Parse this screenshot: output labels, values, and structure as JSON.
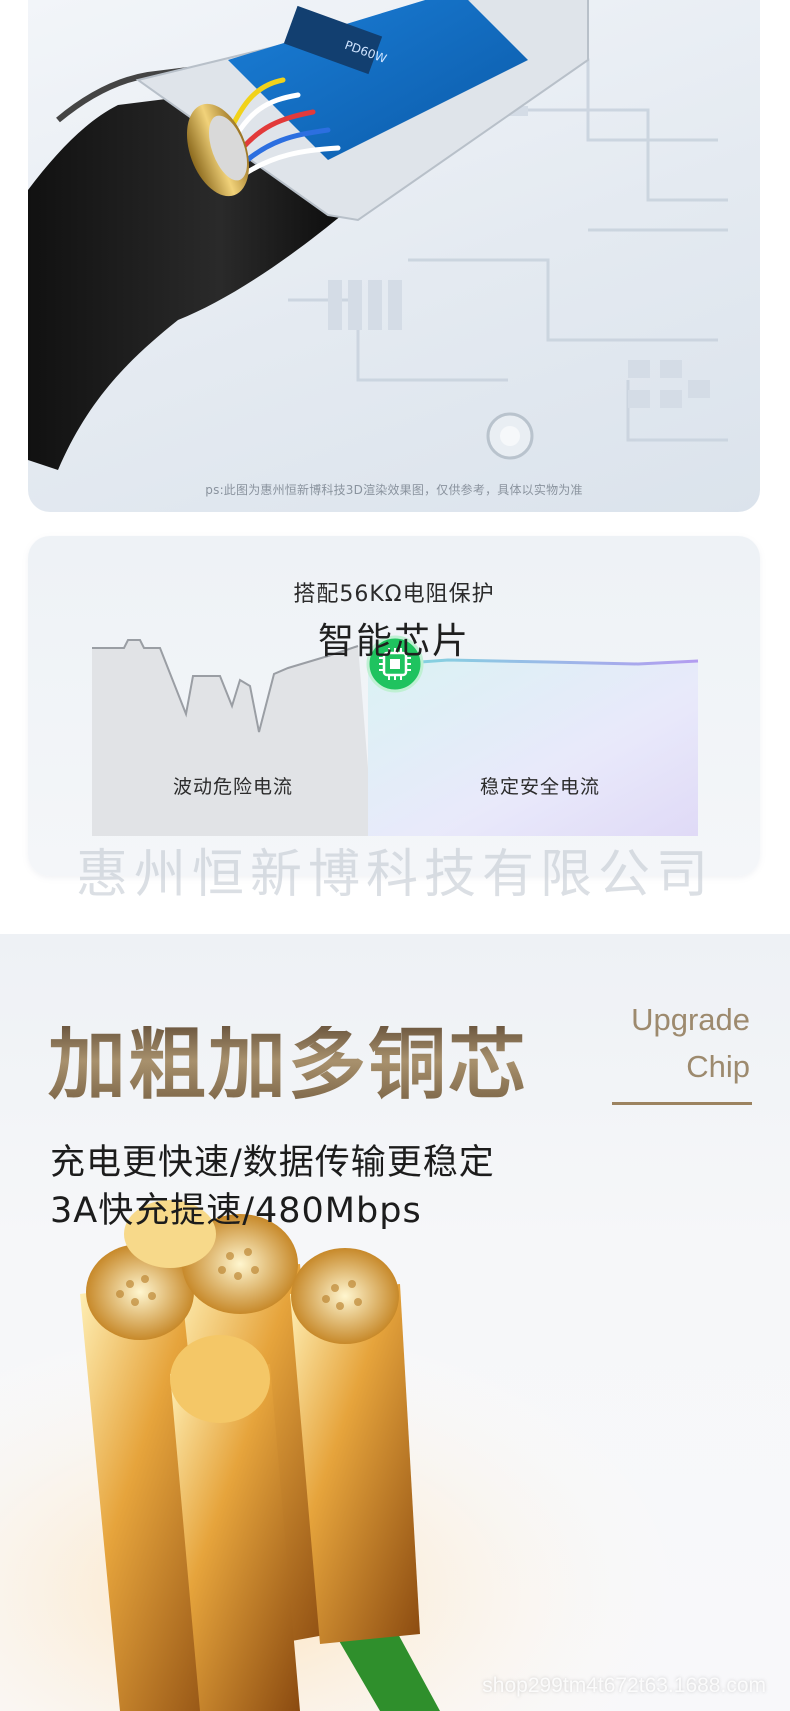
{
  "render": {
    "chip_label": "PD60W",
    "note": "ps:此图为惠州恒新博科技3D渲染效果图，仅供参考，具体以实物为准"
  },
  "smart_chip": {
    "subtitle": "搭配56KΩ电阻保护",
    "title": "智能芯片",
    "left_caption": "波动危险电流",
    "right_caption": "稳定安全电流",
    "chip_icon": "chip-icon",
    "accent_color": "#1fc35f"
  },
  "watermark": {
    "company": "惠州恒新博科技有限公司"
  },
  "copper": {
    "en_line1": "Upgrade",
    "en_line2": "Chip",
    "title": "加粗加多铜芯",
    "desc_line1": "充电更快速/数据传输更稳定",
    "desc_line2": "3A快充提速/480Mbps",
    "title_color": "#8a7352"
  },
  "footer": {
    "shop_url": "shop299tm4t672t63.1688.com"
  }
}
